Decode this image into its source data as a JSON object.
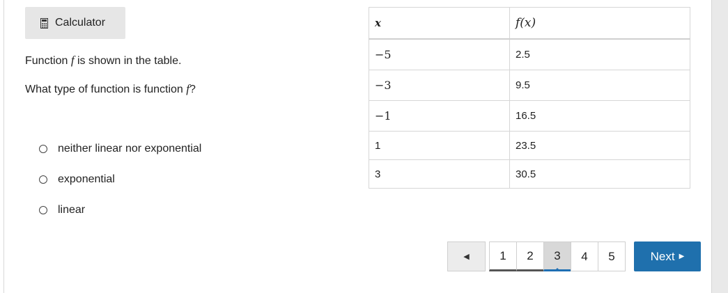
{
  "toolbar": {
    "calculator_label": "Calculator",
    "calculator_icon": "calculator-icon"
  },
  "question": {
    "line1_pre": "Function ",
    "line1_var": "f",
    "line1_post": " is shown in the table.",
    "line2_pre": "What type of function is function ",
    "line2_var": "f",
    "line2_post": "?"
  },
  "options": [
    {
      "label": "neither linear nor exponential",
      "selected": false
    },
    {
      "label": "exponential",
      "selected": false
    },
    {
      "label": "linear",
      "selected": false
    }
  ],
  "table": {
    "headers": [
      "x",
      "f(x)"
    ],
    "rows": [
      [
        "−5",
        "2.5"
      ],
      [
        "−3",
        "9.5"
      ],
      [
        "−1",
        "16.5"
      ],
      [
        "1",
        "23.5"
      ],
      [
        "3",
        "30.5"
      ]
    ]
  },
  "pagination": {
    "prev_icon": "◀",
    "pages": [
      "1",
      "2",
      "3",
      "4",
      "5"
    ],
    "current_page": "3",
    "next_label": "Next",
    "next_icon": "▶"
  },
  "colors": {
    "accent": "#1f70ad",
    "button_bg": "#e6e6e6",
    "current_page_bg": "#d8d8d8"
  }
}
